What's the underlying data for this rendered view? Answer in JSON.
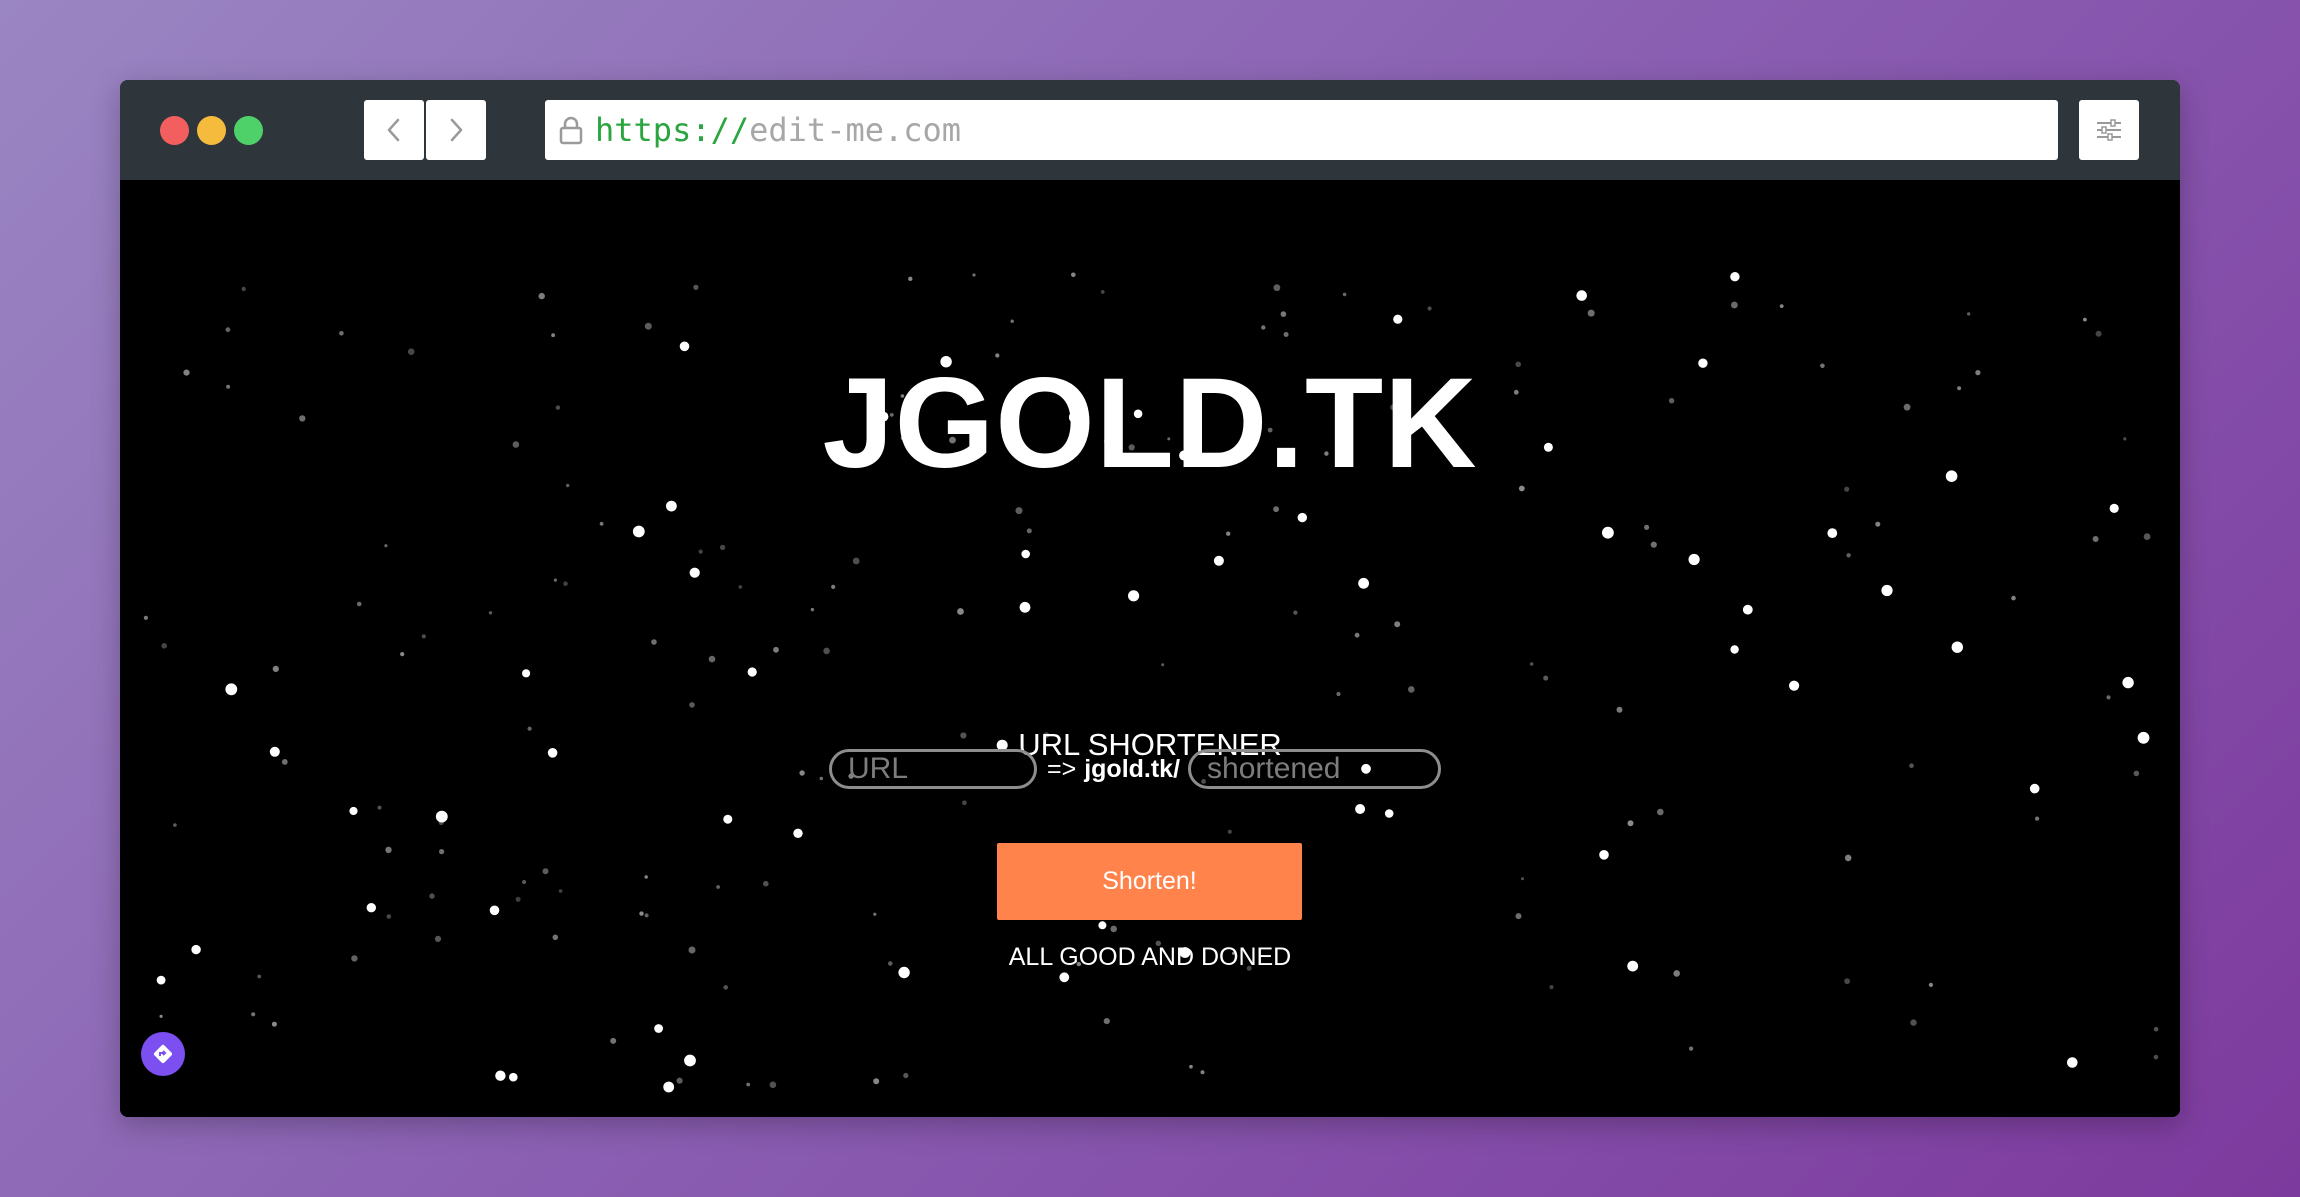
{
  "browser": {
    "url_protocol": "https://",
    "url_host": "edit-me.com",
    "traffic_lights": {
      "close": "#f35f5f",
      "minimize": "#f5bb3d",
      "maximize": "#4fd16a"
    }
  },
  "page": {
    "title": "JGOLD.TK",
    "subtitle": "URL SHORTENER",
    "url_placeholder": "URL",
    "arrow": "=>",
    "domain_prefix": "jgold.tk/",
    "shortened_placeholder": "shortened",
    "button_label": "Shorten!",
    "status": "ALL GOOD AND DONED"
  },
  "colors": {
    "background": "#000000",
    "button": "#ff834a",
    "titlebar": "#2e363b",
    "fab": "#7b4ff0"
  },
  "icons": {
    "back": "chevron-left-icon",
    "forward": "chevron-right-icon",
    "lock": "lock-icon",
    "settings": "sliders-icon",
    "fab": "navigation-diamond-icon"
  }
}
